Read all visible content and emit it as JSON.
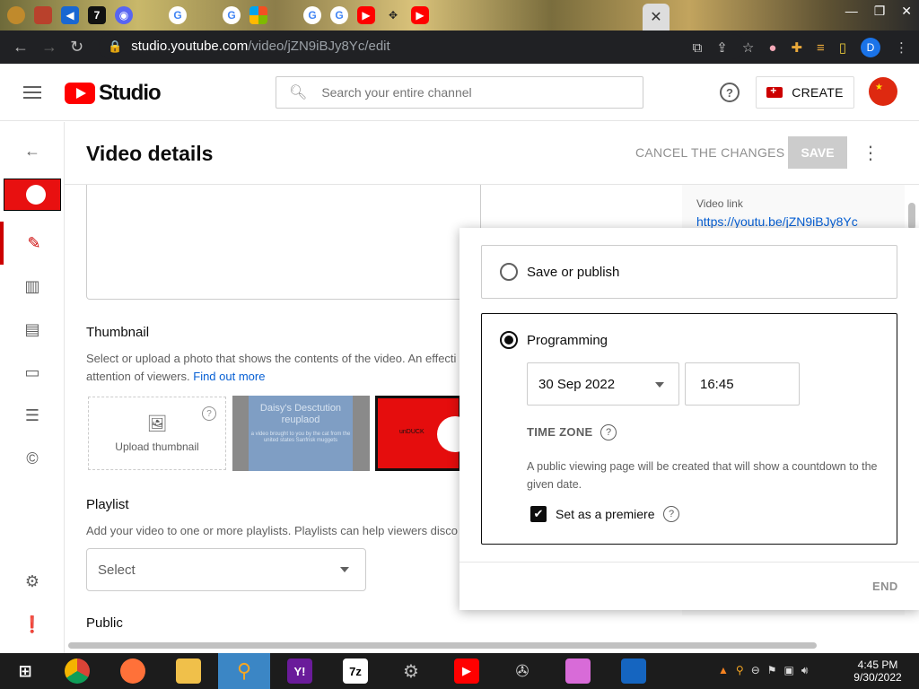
{
  "browser": {
    "url_host": "studio.youtube.com",
    "url_path": "/video/jZN9iBJy8Yc/edit",
    "profile_initial": "D"
  },
  "header": {
    "logo_text": "Studio",
    "search_placeholder": "Search your entire channel",
    "create_label": "CREATE"
  },
  "page": {
    "title": "Video details",
    "cancel_label": "CANCEL THE CHANGES",
    "save_label": "SAVE"
  },
  "thumbnail": {
    "title": "Thumbnail",
    "desc": "Select or upload a photo that shows the contents of the video. An effecti",
    "desc2": "attention of viewers.",
    "link": "Find out more",
    "upload_label": "Upload thumbnail",
    "option1_title": "Daisy's Desctution reuplaod",
    "option1_small": "a video brought to you by the cat from the united states Sanfrisk muggets",
    "option2_text": "unDUCK"
  },
  "playlist": {
    "title": "Playlist",
    "desc": "Add your video to one or more playlists. Playlists can help viewers disco",
    "select_value": "Select"
  },
  "public_section_title": "Public",
  "video_link": {
    "label": "Video link",
    "url": "https://youtu.be/jZN9iBJy8Yc"
  },
  "visibility_popup": {
    "option_save": "Save or publish",
    "option_programming": "Programming",
    "date": "30 Sep 2022",
    "time": "16:45",
    "timezone_label": "TIME ZONE",
    "description": "A public viewing page will be created that will show a countdown to the given date.",
    "premiere_label": "Set as a premiere",
    "premiere_checked": true,
    "end_label": "END"
  },
  "taskbar": {
    "time": "4:45 PM",
    "date": "9/30/2022"
  },
  "colors": {
    "brand_red": "#ff0000",
    "link_blue": "#065fd4",
    "active_red": "#cc0000"
  }
}
